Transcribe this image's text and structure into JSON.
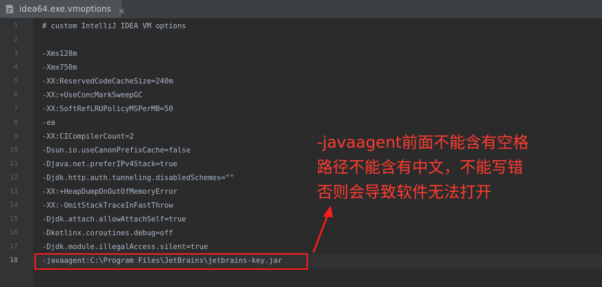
{
  "tab": {
    "title": "idea64.exe.vmoptions",
    "icon": "file-icon"
  },
  "editor": {
    "current_line": 18,
    "lines": [
      {
        "num": "1",
        "text": "# custom IntelliJ IDEA VM options"
      },
      {
        "num": "2",
        "text": ""
      },
      {
        "num": "3",
        "text": "-Xms128m"
      },
      {
        "num": "4",
        "text": "-Xmx750m"
      },
      {
        "num": "5",
        "text": "-XX:ReservedCodeCacheSize=240m"
      },
      {
        "num": "6",
        "text": "-XX:+UseConcMarkSweepGC"
      },
      {
        "num": "7",
        "text": "-XX:SoftRefLRUPolicyMSPerMB=50"
      },
      {
        "num": "8",
        "text": "-ea"
      },
      {
        "num": "9",
        "text": "-XX:CICompilerCount=2"
      },
      {
        "num": "10",
        "text": "-Dsun.io.useCanonPrefixCache=false"
      },
      {
        "num": "11",
        "text": "-Djava.net.preferIPv4Stack=true"
      },
      {
        "num": "12",
        "text": "-Djdk.http.auth.tunneling.disabledSchemes=\"\""
      },
      {
        "num": "13",
        "text": "-XX:+HeapDumpOnOutOfMemoryError"
      },
      {
        "num": "14",
        "text": "-XX:-OmitStackTraceInFastThrow"
      },
      {
        "num": "15",
        "text": "-Djdk.attach.allowAttachSelf=true"
      },
      {
        "num": "16",
        "text": "-Dkotlinx.coroutines.debug=off"
      },
      {
        "num": "17",
        "text": "-Djdk.module.illegalAccess.silent=true"
      },
      {
        "num": "18",
        "text": "-javaagent:C:\\Program Files\\JetBrains\\jetbrains-key.jar"
      }
    ]
  },
  "annotation": {
    "lines": [
      "-javaagent前面不能含有空格",
      "路径不能含有中文，不能写错",
      "否则会导致软件无法打开"
    ],
    "color": "#ff3c30"
  }
}
